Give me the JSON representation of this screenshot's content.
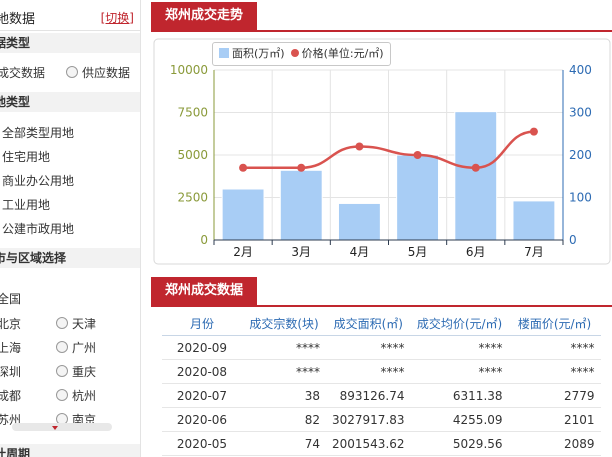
{
  "sidebar": {
    "title": "地数据",
    "switch_label": "[切换]",
    "section_data_type": "据类型",
    "data_options": [
      "成交数据",
      "供应数据"
    ],
    "section_land_type": "地类型",
    "land_types": [
      "全部类型用地",
      "住宅用地",
      "商业办公用地",
      "工业用地",
      "公建市政用地"
    ],
    "section_region": "市与区域选择",
    "region_all": "全国",
    "cities": [
      [
        "北京",
        "天津"
      ],
      [
        "上海",
        "广州"
      ],
      [
        "深圳",
        "重庆"
      ],
      [
        "成都",
        "杭州"
      ],
      [
        "苏州",
        "南京"
      ]
    ],
    "section_period": "计周期"
  },
  "trend_panel": {
    "title": "郑州成交走势"
  },
  "chart_data": {
    "type": "bar",
    "categories": [
      "2月",
      "3月",
      "4月",
      "5月",
      "6月",
      "7月"
    ],
    "series": [
      {
        "name": "面积(万㎡)",
        "type": "bar",
        "axis": "left",
        "values": [
          3000,
          4100,
          2150,
          5000,
          7550,
          2300
        ]
      },
      {
        "name": "价格(单位:元/㎡)",
        "type": "line",
        "axis": "right",
        "values": [
          170,
          170,
          220,
          200,
          170,
          255
        ]
      }
    ],
    "ylim_left": [
      0,
      10000
    ],
    "yticks_left": [
      0,
      2500,
      5000,
      7500,
      10000
    ],
    "ylim_right": [
      0,
      400
    ],
    "yticks_right": [
      0,
      100,
      200,
      300,
      400
    ],
    "legend_position": "top-left",
    "grid": true,
    "colors": {
      "bar": "#a8cdf5",
      "line": "#d9534f",
      "left_axis": "#8a9a3a",
      "right_axis": "#2d6bb3"
    }
  },
  "data_panel": {
    "title": "郑州成交数据",
    "columns": [
      "月份",
      "成交宗数(块)",
      "成交面积(㎡)",
      "成交均价(元/㎡)",
      "楼面价(元/㎡)"
    ],
    "rows": [
      [
        "2020-09",
        "****",
        "****",
        "****",
        "****"
      ],
      [
        "2020-08",
        "****",
        "****",
        "****",
        "****"
      ],
      [
        "2020-07",
        "38",
        "893126.74",
        "6311.38",
        "2779"
      ],
      [
        "2020-06",
        "82",
        "3027917.83",
        "4255.09",
        "2101"
      ],
      [
        "2020-05",
        "74",
        "2001543.62",
        "5029.56",
        "2089"
      ]
    ]
  }
}
